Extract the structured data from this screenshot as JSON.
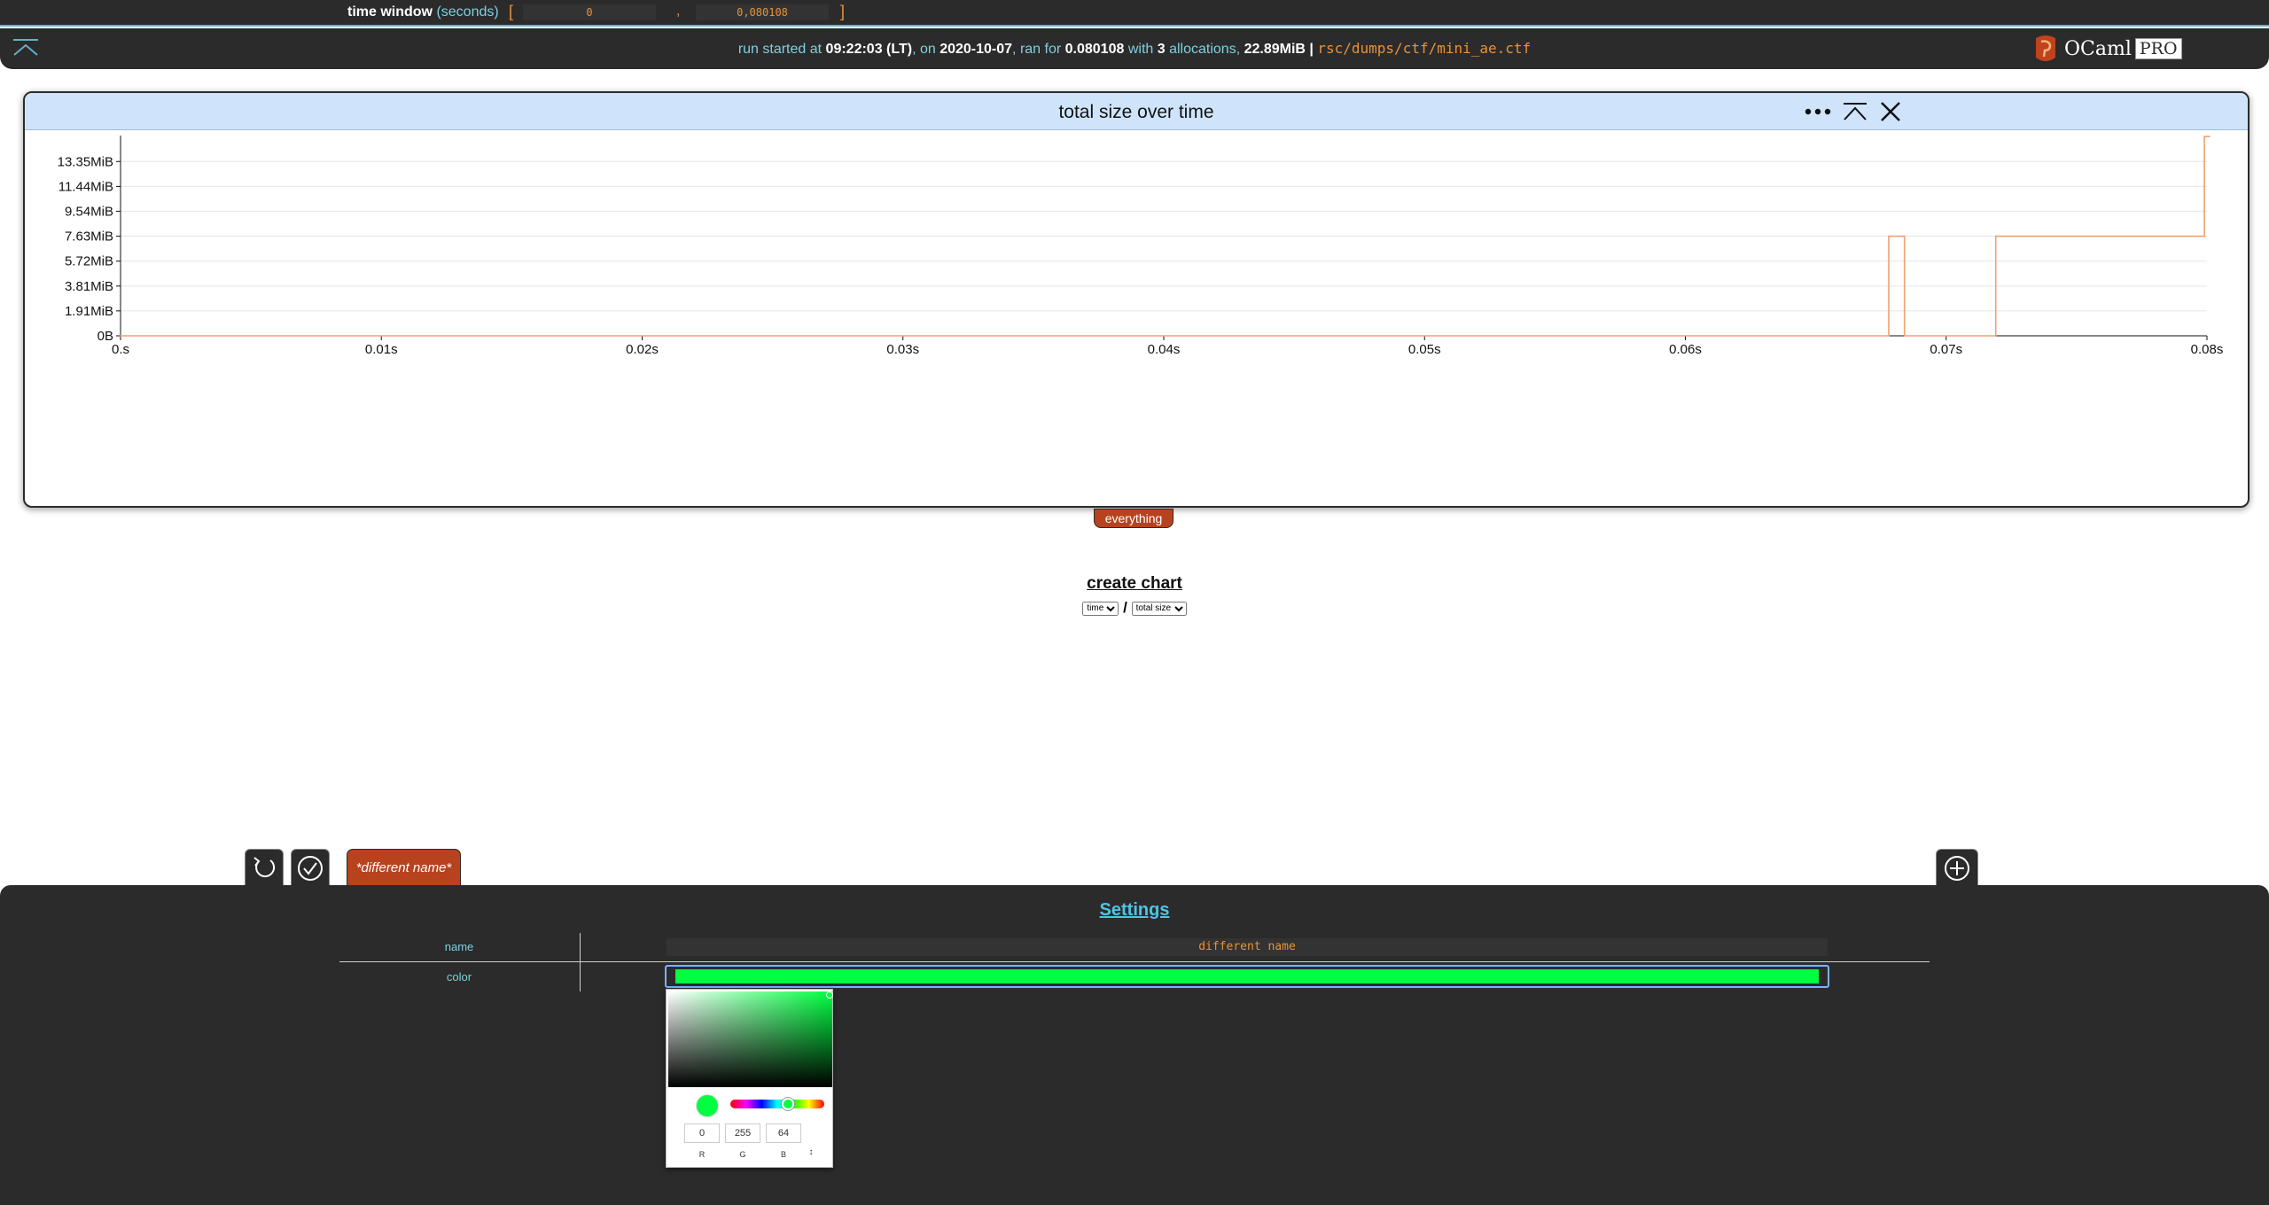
{
  "time_window": {
    "label": "time window",
    "unit": "(seconds)",
    "open_bracket": "[",
    "close_bracket": "]",
    "comma": ",",
    "start": "0",
    "end": "0,080108"
  },
  "header": {
    "run_started_prefix": "run started at",
    "time": "09:22:03 (LT)",
    "on_label": ", on",
    "date": "2020-10-07",
    "ran_for_label": ", ran for",
    "duration": "0.080108",
    "with_label": "with",
    "allocations_count": "3",
    "allocations_label": "allocations,",
    "size": "22.89MiB",
    "separator": "|",
    "path": "rsc/dumps/ctf/mini_ae.ctf",
    "brand_name": "OCaml",
    "brand_suffix": "PRO"
  },
  "chart": {
    "title": "total size over time",
    "filter_tag": "everything",
    "line_color": "#f0a070",
    "icons": [
      "more-icon",
      "collapse-icon",
      "close-icon"
    ]
  },
  "chart_data": {
    "type": "line",
    "title": "total size over time",
    "step": true,
    "xlim": [
      0,
      0.08
    ],
    "ylim": [
      0,
      15.2
    ],
    "x_tick_labels": [
      "0.s",
      "0.01s",
      "0.02s",
      "0.03s",
      "0.04s",
      "0.05s",
      "0.06s",
      "0.07s",
      "0.08s"
    ],
    "x_ticks": [
      0,
      0.01,
      0.02,
      0.03,
      0.04,
      0.05,
      0.06,
      0.07,
      0.08
    ],
    "y_tick_labels": [
      "0B",
      "1.91MiB",
      "3.81MiB",
      "5.72MiB",
      "7.63MiB",
      "9.54MiB",
      "11.44MiB",
      "13.35MiB"
    ],
    "y_ticks": [
      0,
      1.91,
      3.81,
      5.72,
      7.63,
      9.54,
      11.44,
      13.35
    ],
    "grid": true,
    "series": [
      {
        "x": [
          0,
          0.0678,
          0.0678,
          0.0684,
          0.0684,
          0.0719,
          0.0719,
          0.0799,
          0.0799,
          0.0801
        ],
        "y": [
          0,
          0,
          7.63,
          7.63,
          0,
          0,
          7.63,
          7.63,
          15.26,
          15.26
        ],
        "color": "#f0a070"
      }
    ]
  },
  "create_chart": {
    "label": "create chart",
    "x_axis": "time",
    "y_axis": "total size",
    "separator": "/"
  },
  "filters": {
    "active_tab": "*different name*"
  },
  "settings": {
    "title": "Settings",
    "name_label": "name",
    "name_value": "different name",
    "color_label": "color",
    "color_value": "#00ff40"
  },
  "color_picker": {
    "r": "0",
    "g": "255",
    "b": "64",
    "r_label": "R",
    "g_label": "G",
    "b_label": "B",
    "mode_toggle": "↕"
  }
}
